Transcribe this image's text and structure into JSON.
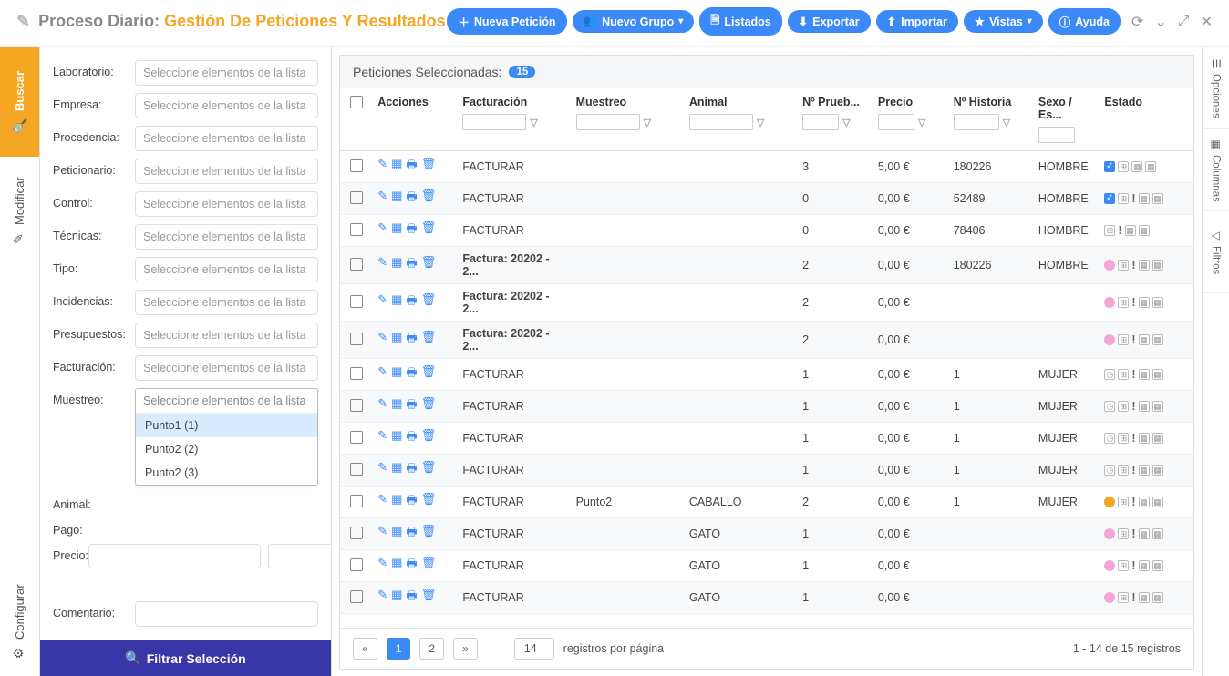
{
  "breadcrumb": {
    "prefix": "Proceso Diario:",
    "title": "Gestión De Peticiones Y Resultados"
  },
  "toolbar": {
    "nueva_peticion": "Nueva Petición",
    "nuevo_grupo": "Nuevo Grupo",
    "listados": "Listados",
    "exportar": "Exportar",
    "importar": "Importar",
    "vistas": "Vistas",
    "ayuda": "Ayuda"
  },
  "left_tabs": {
    "buscar": "Buscar",
    "modificar": "Modificar",
    "configurar": "Configurar"
  },
  "right_tabs": {
    "opciones": "Opciones",
    "columnas": "Columnas",
    "filtros": "Filtros"
  },
  "filters": {
    "laboratorio": "Laboratorio:",
    "empresa": "Empresa:",
    "procedencia": "Procedencia:",
    "peticionario": "Peticionario:",
    "control": "Control:",
    "tecnicas": "Técnicas:",
    "tipo": "Tipo:",
    "incidencias": "Incidencias:",
    "presupuestos": "Presupuestos:",
    "facturacion": "Facturación:",
    "muestreo": "Muestreo:",
    "animal": "Animal:",
    "pago": "Pago:",
    "precio": "Precio:",
    "comentario": "Comentario:",
    "placeholder": "Seleccione elementos de la lista",
    "muestreo_options": [
      "Punto1 (1)",
      "Punto2 (2)",
      "Punto2 (3)"
    ],
    "submit": "Filtrar Selección"
  },
  "content": {
    "header_label": "Peticiones Seleccionadas:",
    "badge": "15",
    "columns": {
      "acciones": "Acciones",
      "facturacion": "Facturación",
      "muestreo": "Muestreo",
      "animal": "Animal",
      "npruebas": "Nº Prueb...",
      "precio": "Precio",
      "nhistoria": "Nº Historia",
      "sexo": "Sexo / Es...",
      "estado": "Estado"
    },
    "rows": [
      {
        "fact": "FACTURAR",
        "mues": "",
        "anim": "",
        "np": "3",
        "prc": "5,00 €",
        "nh": "180226",
        "sex": "HOMBRE",
        "est": "blue-check squares"
      },
      {
        "fact": "FACTURAR",
        "mues": "",
        "anim": "",
        "np": "0",
        "prc": "0,00 €",
        "nh": "52489",
        "sex": "HOMBRE",
        "est": "blue-check squares ex"
      },
      {
        "fact": "FACTURAR",
        "mues": "",
        "anim": "",
        "np": "0",
        "prc": "0,00 €",
        "nh": "78406",
        "sex": "HOMBRE",
        "est": "squares ex"
      },
      {
        "fact": "Factura: 20202 - 2...",
        "b": true,
        "mues": "",
        "anim": "",
        "np": "2",
        "prc": "0,00 €",
        "nh": "180226",
        "sex": "HOMBRE",
        "est": "pink squares ex"
      },
      {
        "fact": "Factura: 20202 - 2...",
        "b": true,
        "mues": "",
        "anim": "",
        "np": "2",
        "prc": "0,00 €",
        "nh": "",
        "sex": "",
        "est": "pink squares ex"
      },
      {
        "fact": "Factura: 20202 - 2...",
        "b": true,
        "mues": "",
        "anim": "",
        "np": "2",
        "prc": "0,00 €",
        "nh": "",
        "sex": "",
        "est": "pink squares ex"
      },
      {
        "fact": "FACTURAR",
        "mues": "",
        "anim": "",
        "np": "1",
        "prc": "0,00 €",
        "nh": "1",
        "sex": "MUJER",
        "est": "clock squares ex"
      },
      {
        "fact": "FACTURAR",
        "mues": "",
        "anim": "",
        "np": "1",
        "prc": "0,00 €",
        "nh": "1",
        "sex": "MUJER",
        "est": "clock squares ex"
      },
      {
        "fact": "FACTURAR",
        "mues": "",
        "anim": "",
        "np": "1",
        "prc": "0,00 €",
        "nh": "1",
        "sex": "MUJER",
        "est": "clock squares ex"
      },
      {
        "fact": "FACTURAR",
        "mues": "",
        "anim": "",
        "np": "1",
        "prc": "0,00 €",
        "nh": "1",
        "sex": "MUJER",
        "est": "clock squares ex"
      },
      {
        "fact": "FACTURAR",
        "mues": "Punto2",
        "anim": "CABALLO",
        "np": "2",
        "prc": "0,00 €",
        "nh": "1",
        "sex": "MUJER",
        "est": "orange squares ex"
      },
      {
        "fact": "FACTURAR",
        "mues": "",
        "anim": "GATO",
        "np": "1",
        "prc": "0,00 €",
        "nh": "",
        "sex": "",
        "est": "pink squares ex"
      },
      {
        "fact": "FACTURAR",
        "mues": "",
        "anim": "GATO",
        "np": "1",
        "prc": "0,00 €",
        "nh": "",
        "sex": "",
        "est": "pink squares ex"
      },
      {
        "fact": "FACTURAR",
        "mues": "",
        "anim": "GATO",
        "np": "1",
        "prc": "0,00 €",
        "nh": "",
        "sex": "",
        "est": "pink squares ex"
      }
    ],
    "pager": {
      "page_size": "14",
      "label": "registros por página",
      "info": "1 - 14 de 15 registros",
      "pages": [
        "1",
        "2"
      ]
    }
  }
}
